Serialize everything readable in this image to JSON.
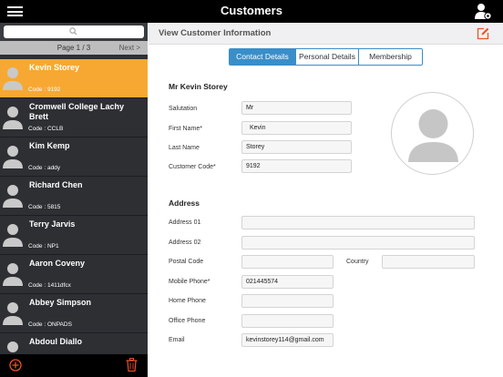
{
  "topbar": {
    "title": "Customers",
    "menu_icon": "hamburger-menu-icon",
    "right_icon": "user-settings-icon"
  },
  "sidebar": {
    "search": {
      "placeholder": "",
      "icon": "search-icon"
    },
    "pager": {
      "page_label": "Page 1 / 3",
      "next_label": "Next >"
    },
    "customers": [
      {
        "name": "Kevin Storey",
        "code": "Code : 9192",
        "active": true
      },
      {
        "name": "Cromwell College Lachy Brett",
        "code": "Code : CCLB",
        "active": false
      },
      {
        "name": "Kim Kemp",
        "code": "Code : addy",
        "active": false
      },
      {
        "name": "Richard Chen",
        "code": "Code : 5815",
        "active": false
      },
      {
        "name": "Terry  Jarvis",
        "code": "Code : NP1",
        "active": false
      },
      {
        "name": "Aaron Coveny",
        "code": "Code : 1411dfcx",
        "active": false
      },
      {
        "name": "Abbey Simpson",
        "code": "Code : ONPADS",
        "active": false
      },
      {
        "name": "Abdoul  Diallo",
        "code": "",
        "active": false
      }
    ],
    "footer": {
      "add_icon": "add-circle-icon",
      "delete_icon": "trash-icon"
    }
  },
  "main": {
    "header": {
      "title": "View Customer Information",
      "edit_icon": "edit-icon"
    },
    "tabs": [
      {
        "label": "Contact Details",
        "active": true
      },
      {
        "label": "Personal Details",
        "active": false
      },
      {
        "label": "Membership",
        "active": false
      }
    ],
    "customer_heading": "Mr  Kevin Storey",
    "contact": {
      "salutation": {
        "label": "Salutation",
        "value": "Mr"
      },
      "first_name": {
        "label": "First Name*",
        "value": "Kevin"
      },
      "last_name": {
        "label": "Last Name",
        "value": "Storey"
      },
      "customer_code": {
        "label": "Customer Code*",
        "value": "9192"
      }
    },
    "address": {
      "heading": "Address",
      "address01": {
        "label": "Address 01",
        "value": ""
      },
      "address02": {
        "label": "Address 02",
        "value": ""
      },
      "postal_code": {
        "label": "Postal Code",
        "value": ""
      },
      "country": {
        "label": "Country",
        "value": ""
      },
      "mobile_phone": {
        "label": "Mobile Phone*",
        "value": "021445574"
      },
      "home_phone": {
        "label": "Home Phone",
        "value": ""
      },
      "office_phone": {
        "label": "Office Phone",
        "value": ""
      },
      "email": {
        "label": "Email",
        "value": "kevinstorey114@gmail.com"
      }
    },
    "photo_icon": "avatar-placeholder-icon"
  },
  "colors": {
    "accent": "#f7a832",
    "tab_blue": "#3a8ec8",
    "sidebar_bg": "#2d2f33",
    "edit_icon": "#e8542a",
    "footer_icon": "#e8542a"
  }
}
